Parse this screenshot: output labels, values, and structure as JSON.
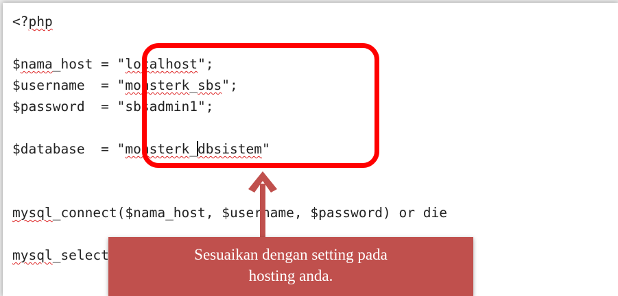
{
  "code_lines": [
    "<?php",
    "",
    "$nama_host = \"localhost\";",
    "$username  = \"monsterk_sbs\";",
    "$password  = \"sbsadmin1\";",
    "",
    "$database  = \"monsterk_dbsistem\"",
    "",
    "",
    "mysql_connect($nama_host, $username, $password) or die",
    "",
    "mysql_select_db($database) or die(mysql_error());"
  ],
  "callout": {
    "line1": "Sesuaikan dengan setting pada",
    "line2": "hosting  anda."
  },
  "colors": {
    "highlight_border": "#ff0000",
    "callout_background": "#c0504d",
    "arrow": "#c0504d",
    "spellcheck_underline": "#dd2222"
  },
  "icons": [
    "up-arrow-icon"
  ]
}
